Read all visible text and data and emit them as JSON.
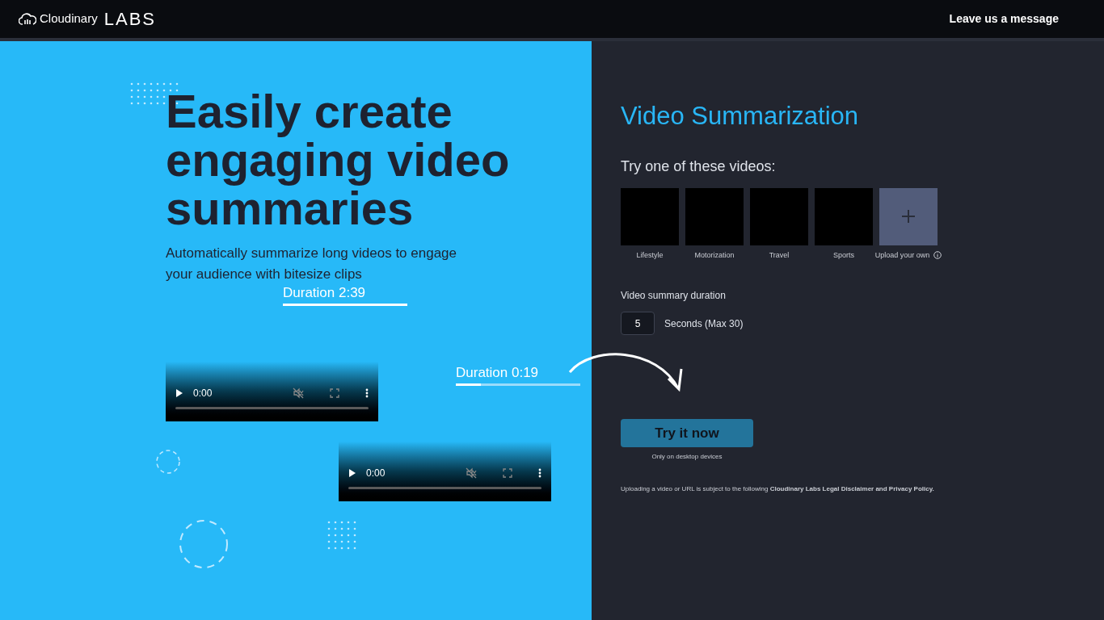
{
  "header": {
    "brand": "Cloudinary",
    "brand_suffix": "LABS",
    "link": "Leave us a message"
  },
  "hero": {
    "title": "Easily create engaging video summaries",
    "subtitle": "Automatically summarize long videos to engage your audience with bitesize clips",
    "durations": [
      {
        "label": "Duration 2:39",
        "level": 1
      },
      {
        "label": "Duration 0:19",
        "level": 0.2
      }
    ],
    "videos": [
      {
        "time": "0:00"
      },
      {
        "time": "0:00"
      }
    ]
  },
  "panel": {
    "title": "Video Summarization",
    "prompt": "Try one of these videos:",
    "samples": [
      {
        "label": "Lifestyle",
        "kind": "video"
      },
      {
        "label": "Motorization",
        "kind": "video"
      },
      {
        "label": "Travel",
        "kind": "video"
      },
      {
        "label": "Sports",
        "kind": "video"
      },
      {
        "label": "Upload your own",
        "kind": "upload"
      }
    ],
    "duration_label": "Video summary duration",
    "duration_value": "5",
    "duration_unit": "Seconds (Max 30)",
    "button": "Try it now",
    "note": "Only on desktop devices",
    "disclaimer": "Uploading a video or URL is subject to the following **Cloudinary Labs Legal Disclaimer and Privacy Policy.**"
  }
}
